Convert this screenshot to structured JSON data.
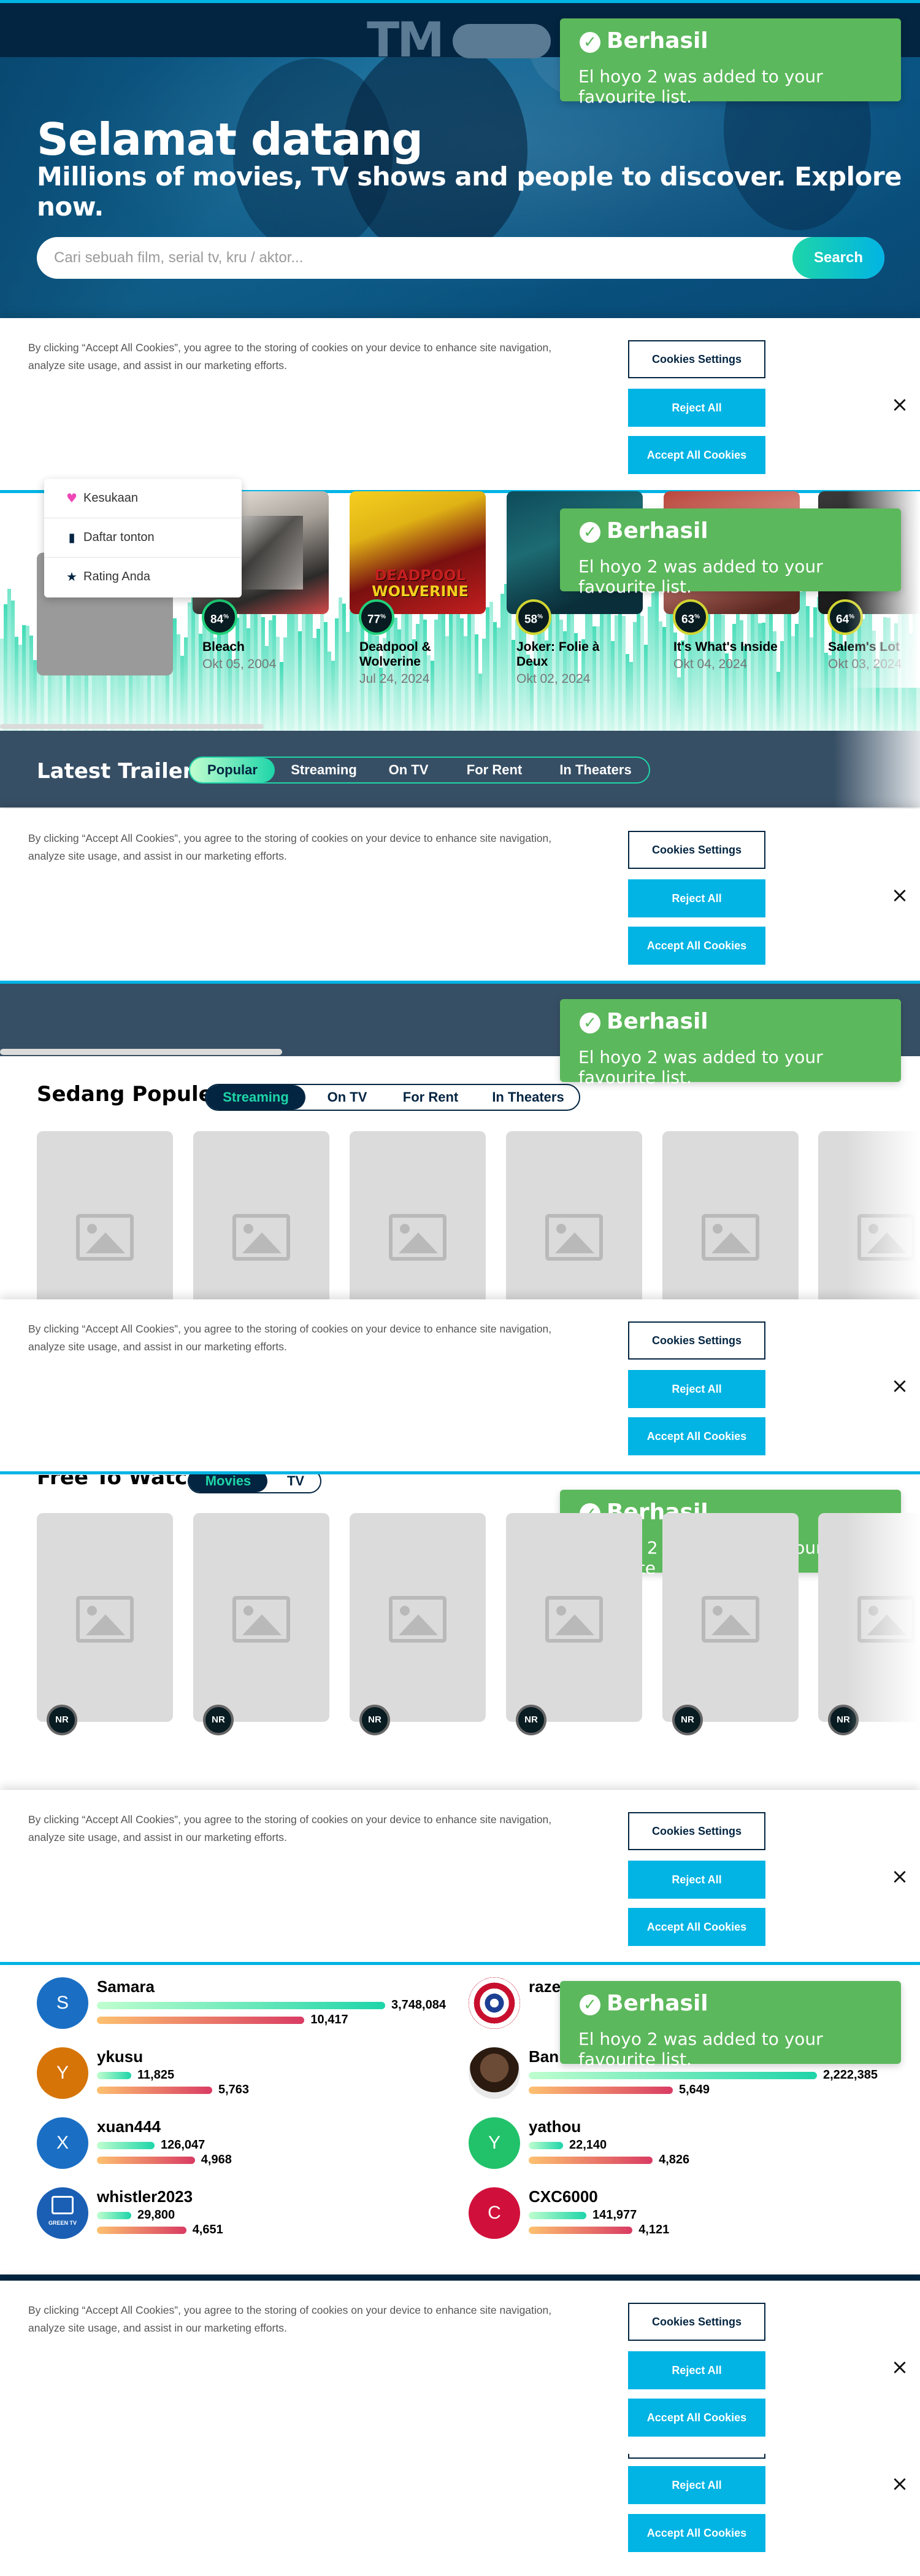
{
  "hero": {
    "logo_text": "TM",
    "title": "Selamat datang",
    "subtitle": "Millions of movies, TV shows and people to discover. Explore now.",
    "search_placeholder": "Cari sebuah film, serial tv, kru / aktor...",
    "search_button": "Search"
  },
  "toast": {
    "title": "Berhasil",
    "message": "El hoyo 2 was added to your favourite list.",
    "icon": "check-circle-icon",
    "color": "#5cb85c"
  },
  "cookie": {
    "text": "By clicking “Accept All Cookies”, you agree to the storing of cookies on your device to enhance site navigation, analyze site usage, and assist in our marketing efforts.",
    "settings": "Cookies Settings",
    "reject": "Reject All",
    "accept": "Accept All Cookies",
    "close": "×"
  },
  "dropdown": {
    "items": [
      {
        "label": "Kesukaan",
        "icon": "heart-icon"
      },
      {
        "label": "Daftar tonton",
        "icon": "bookmark-icon"
      },
      {
        "label": "Rating Anda",
        "icon": "star-icon"
      }
    ]
  },
  "trending": [
    {
      "title": "Bleach",
      "date": "Okt 05, 2004",
      "score": "84"
    },
    {
      "title": "Deadpool & Wolverine",
      "date": "Jul 24, 2024",
      "score": "77"
    },
    {
      "title": "Joker: Folie à Deux",
      "date": "Okt 02, 2024",
      "score": "58"
    },
    {
      "title": "It's What's Inside",
      "date": "Okt 04, 2024",
      "score": "63"
    },
    {
      "title": "Salem's Lot",
      "date": "Okt 03, 2024",
      "score": "64"
    }
  ],
  "poster_text": {
    "deadpool": "DEADPOOL",
    "wolverine": "WOLVERINE"
  },
  "trailers": {
    "title": "Latest Trailers",
    "tabs": [
      "Popular",
      "Streaming",
      "On TV",
      "For Rent",
      "In Theaters"
    ]
  },
  "popular": {
    "title": "Sedang Populer",
    "tabs": [
      "Streaming",
      "On TV",
      "For Rent",
      "In Theaters"
    ]
  },
  "free": {
    "title": "Free To Watch",
    "tabs": [
      "Movies",
      "TV"
    ],
    "badge": "NR"
  },
  "leaderboard": {
    "left": [
      {
        "name": "Samara",
        "initial": "S",
        "edits": "3,748,084",
        "other": "10,417",
        "color": "#1a6fc4",
        "top_fill": 1.0,
        "bottom_fill": 0.72
      },
      {
        "name": "ykusu",
        "initial": "Y",
        "edits": "11,825",
        "other": "5,763",
        "color": "#d67408",
        "top_fill": 0.1,
        "bottom_fill": 0.4
      },
      {
        "name": "xuan444",
        "initial": "X",
        "edits": "126,047",
        "other": "4,968",
        "color": "#1a6fc4",
        "top_fill": 0.2,
        "bottom_fill": 0.34
      },
      {
        "name": "whistler2023",
        "initial": "",
        "edits": "29,800",
        "other": "4,651",
        "color": "#1a5fb4",
        "top_fill": 0.11,
        "bottom_fill": 0.31
      }
    ],
    "right": [
      {
        "name": "raze",
        "initial": "",
        "edits": "",
        "other": "",
        "color": "#b11b22",
        "top_fill": 0.0,
        "bottom_fill": 0.0
      },
      {
        "name": "Ban",
        "initial": "",
        "edits": "2,222,385",
        "other": "5,649",
        "color": "#5a3b2a",
        "top_fill": 1.0,
        "bottom_fill": 0.5
      },
      {
        "name": "yathou",
        "initial": "Y",
        "edits": "22,140",
        "other": "4,826",
        "color": "#21c26a",
        "top_fill": 0.1,
        "bottom_fill": 0.43
      },
      {
        "name": "CXC6000",
        "initial": "C",
        "edits": "141,977",
        "other": "4,121",
        "color": "#d0103a",
        "top_fill": 0.2,
        "bottom_fill": 0.36
      }
    ],
    "green_tv_label": "GREEN TV"
  }
}
